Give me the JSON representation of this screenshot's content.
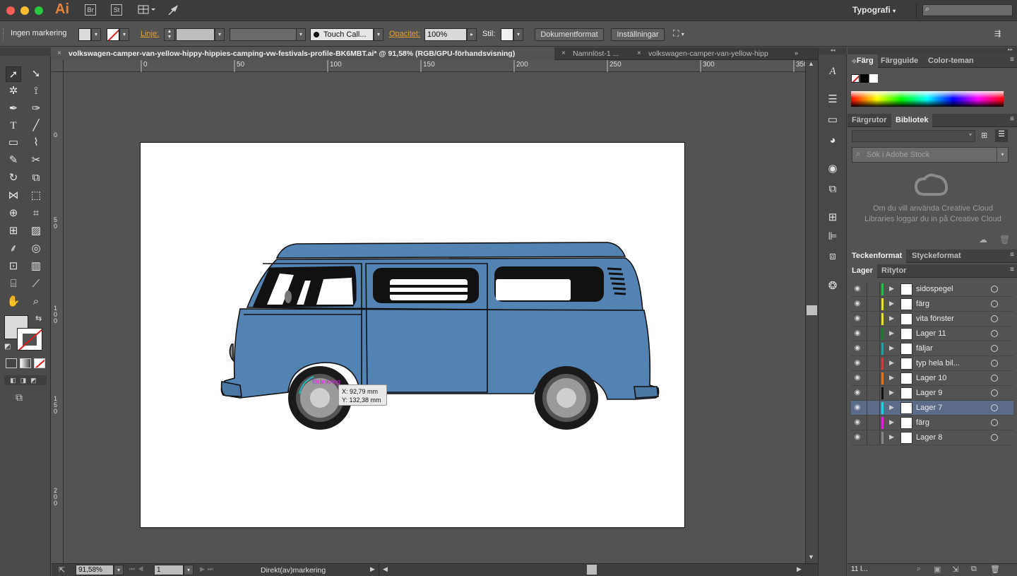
{
  "app": {
    "logo": "Ai",
    "bridge": "Br",
    "stock": "St",
    "workspace": "Typografi",
    "search_placeholder": ""
  },
  "control_bar": {
    "selection_label": "Ingen markering",
    "stroke_label": "Linje:",
    "brush_label": "Touch Call...",
    "opacity_label": "Opacitet:",
    "opacity_value": "100%",
    "style_label": "Stil:",
    "doc_format_button": "Dokumentformat",
    "settings_button": "Inställningar"
  },
  "tabs": [
    {
      "label": "volkswagen-camper-van-yellow-hippy-hippies-camping-vw-festivals-profile-BK6MBT.ai* @ 91,58% (RGB/GPU-förhandsvisning)",
      "active": true
    },
    {
      "label": "Namnlöst-1 ...",
      "active": false
    },
    {
      "label": "volkswagen-camper-van-yellow-hipp",
      "active": false
    }
  ],
  "ruler_h_labels": [
    "0",
    "50",
    "100",
    "150",
    "200",
    "250",
    "300",
    "350"
  ],
  "ruler_v_labels": [
    "0",
    "5 0",
    "1 0 0",
    "1 5 0",
    "2 0 0"
  ],
  "canvas": {
    "anchor_label": "förankring",
    "tooltip_x": "X: 92,79 mm",
    "tooltip_y": "Y: 132,38 mm"
  },
  "status": {
    "zoom": "91,58%",
    "artboard_number": "1",
    "tool_name": "Direkt(av)markering"
  },
  "color_panel": {
    "tabs": [
      "Färg",
      "Färgguide",
      "Color-teman"
    ]
  },
  "library_panel": {
    "tabs": [
      "Färgrutor",
      "Bibliotek"
    ],
    "search_placeholder": "Sök i Adobe Stock",
    "message": "Om du vill använda Creative Cloud Libraries loggar du in på Creative Cloud"
  },
  "char_panel": {
    "tabs": [
      "Teckenformat",
      "Styckeformat"
    ]
  },
  "layers_panel": {
    "tabs": [
      "Lager",
      "Ritytor"
    ],
    "footer_count": "11 l...",
    "layers": [
      {
        "name": "sidospegel",
        "color": "#22c04a",
        "selected": false
      },
      {
        "name": "färg",
        "color": "#e6e22e",
        "selected": false
      },
      {
        "name": "vita fönster",
        "color": "#e6e22e",
        "selected": false
      },
      {
        "name": "Lager 11",
        "color": "#1f7a2a",
        "selected": false
      },
      {
        "name": "fäljar",
        "color": "#1e9fa0",
        "selected": false
      },
      {
        "name": "typ hela bil...",
        "color": "#d23a3a",
        "selected": false
      },
      {
        "name": "Lager 10",
        "color": "#e8751e",
        "selected": false
      },
      {
        "name": "Lager 9",
        "color": "#111111",
        "selected": false
      },
      {
        "name": "Lager 7",
        "color": "#23d0e0",
        "selected": true
      },
      {
        "name": "färg",
        "color": "#e01fe0",
        "selected": false
      },
      {
        "name": "Lager 8",
        "color": "#888888",
        "selected": false
      }
    ]
  },
  "colors": {
    "van_body": "#5383b3",
    "accent_orange": "#e8a033"
  }
}
